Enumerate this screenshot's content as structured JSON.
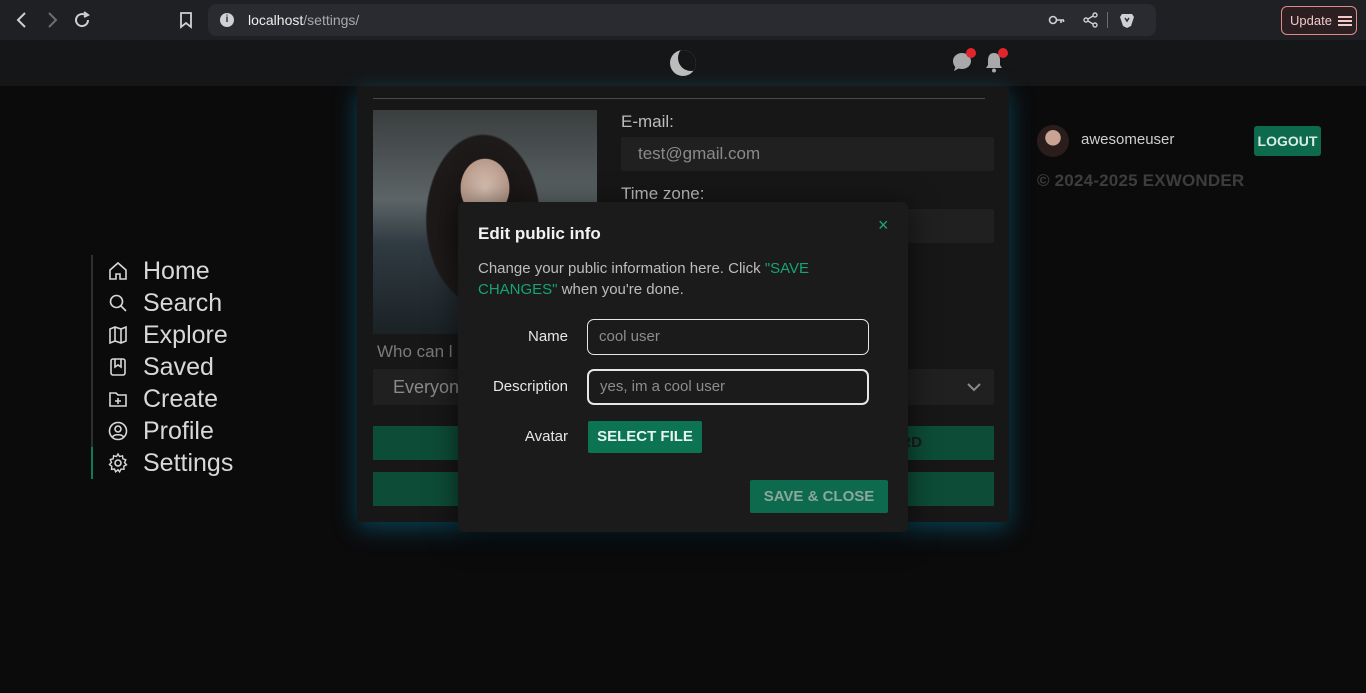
{
  "browser": {
    "url_host": "localhost",
    "url_path": "/settings/",
    "update_label": "Update"
  },
  "sidebar": {
    "items": [
      {
        "label": "Home",
        "icon": "home-icon"
      },
      {
        "label": "Search",
        "icon": "search-icon"
      },
      {
        "label": "Explore",
        "icon": "map-icon"
      },
      {
        "label": "Saved",
        "icon": "bookmark-icon"
      },
      {
        "label": "Create",
        "icon": "folder-plus-icon"
      },
      {
        "label": "Profile",
        "icon": "user-circle-icon"
      },
      {
        "label": "Settings",
        "icon": "gear-icon"
      }
    ],
    "active": "Settings"
  },
  "settings_card": {
    "email_label": "E-mail:",
    "email_value": "test@gmail.com",
    "timezone_label": "Time zone:",
    "who_can_label": "Who can l",
    "who_can_value": "Everyon",
    "button_partial": "RD"
  },
  "user_panel": {
    "username": "awesomeuser",
    "logout_label": "LOGOUT",
    "copyright": "© 2024-2025 EXWONDER"
  },
  "modal": {
    "title": "Edit public info",
    "close_symbol": "×",
    "desc_pre": "Change your public information here. Click ",
    "desc_accent": "\"SAVE CHANGES\"",
    "desc_post": " when you're done.",
    "name_label": "Name",
    "name_value": "cool user",
    "description_label": "Description",
    "description_value": "yes, im a cool user",
    "avatar_label": "Avatar",
    "select_file_label": "SELECT FILE",
    "save_close_label": "SAVE & CLOSE"
  },
  "colors": {
    "accent": "#0c7453",
    "accent_text": "#16a476",
    "badge": "#e0262b"
  }
}
